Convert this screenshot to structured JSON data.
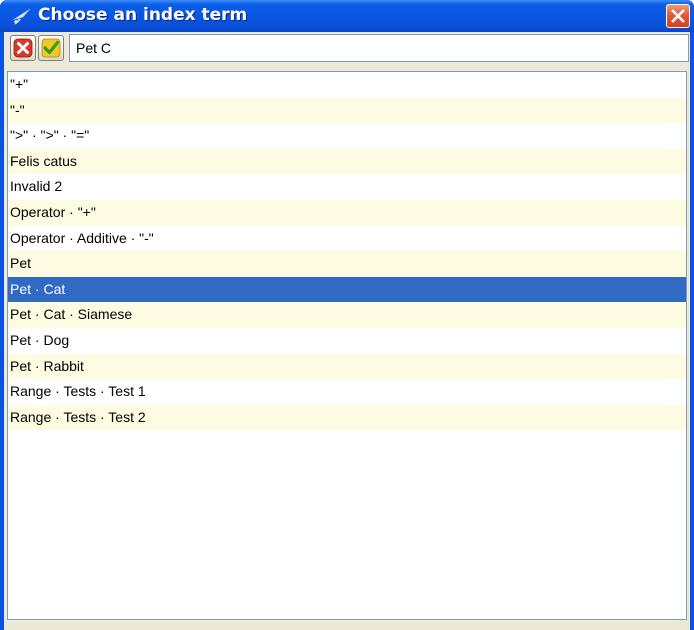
{
  "window": {
    "title": "Choose an index term"
  },
  "search": {
    "value": "Pet C"
  },
  "toolbar": {
    "cancel_icon": "cancel-icon",
    "ok_icon": "checkmark-icon"
  },
  "list": {
    "selected_index": 8,
    "items": [
      {
        "label": "\"+\""
      },
      {
        "label": "\"-\""
      },
      {
        "label": "\">\" · \">\" · \"=\""
      },
      {
        "label": "Felis catus"
      },
      {
        "label": "Invalid 2"
      },
      {
        "label": "Operator · \"+\""
      },
      {
        "label": "Operator · Additive · \"-\""
      },
      {
        "label": "Pet"
      },
      {
        "label": "Pet · Cat"
      },
      {
        "label": "Pet · Cat · Siamese"
      },
      {
        "label": "Pet · Dog"
      },
      {
        "label": "Pet · Rabbit"
      },
      {
        "label": "Range · Tests · Test 1"
      },
      {
        "label": "Range · Tests · Test 2"
      }
    ]
  },
  "colors": {
    "titlebar": "#0a55e2",
    "selection": "#316ac5",
    "alt_row": "#fdfbe2",
    "close_button": "#e2583a"
  }
}
